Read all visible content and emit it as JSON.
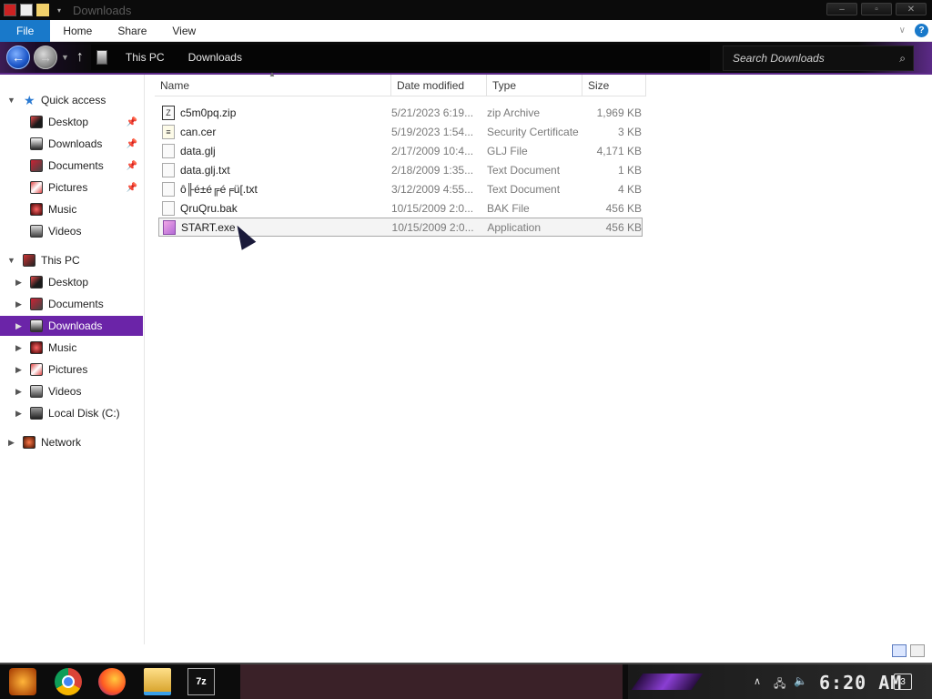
{
  "window": {
    "title": "Downloads",
    "controls": {
      "minimize": "–",
      "maximize": "▫",
      "close": "✕"
    }
  },
  "ribbon": {
    "tabs": [
      "File",
      "Home",
      "Share",
      "View"
    ],
    "help": "?"
  },
  "nav": {
    "breadcrumb": [
      "This PC",
      "Downloads"
    ],
    "search_placeholder": "Search Downloads"
  },
  "sidebar": {
    "quick_access": "Quick access",
    "quick_items": [
      {
        "label": "Desktop",
        "pinned": true
      },
      {
        "label": "Downloads",
        "pinned": true
      },
      {
        "label": "Documents",
        "pinned": true
      },
      {
        "label": "Pictures",
        "pinned": true
      },
      {
        "label": "Music",
        "pinned": false
      },
      {
        "label": "Videos",
        "pinned": false
      }
    ],
    "this_pc": "This PC",
    "pc_items": [
      "Desktop",
      "Documents",
      "Downloads",
      "Music",
      "Pictures",
      "Videos",
      "Local Disk (C:)"
    ],
    "selected": "Downloads",
    "network": "Network"
  },
  "columns": [
    "Name",
    "Date modified",
    "Type",
    "Size"
  ],
  "files": [
    {
      "name": "c5m0pq.zip",
      "date": "5/21/2023 6:19...",
      "type": "zip Archive",
      "size": "1,969 KB",
      "icon": "zip-icon"
    },
    {
      "name": "can.cer",
      "date": "5/19/2023 1:54...",
      "type": "Security Certificate",
      "size": "3 KB",
      "icon": "certificate-icon"
    },
    {
      "name": "data.glj",
      "date": "2/17/2009 10:4...",
      "type": "GLJ File",
      "size": "4,171 KB",
      "icon": "file-icon"
    },
    {
      "name": "data.glj.txt",
      "date": "2/18/2009 1:35...",
      "type": "Text Document",
      "size": "1 KB",
      "icon": "file-icon"
    },
    {
      "name": "ô╟é±é╔é╒ü[.txt",
      "date": "3/12/2009 4:55...",
      "type": "Text Document",
      "size": "4 KB",
      "icon": "file-icon"
    },
    {
      "name": "QruQru.bak",
      "date": "10/15/2009 2:0...",
      "type": "BAK File",
      "size": "456 KB",
      "icon": "file-icon"
    },
    {
      "name": "START.exe",
      "date": "10/15/2009 2:0...",
      "type": "Application",
      "size": "456 KB",
      "icon": "exe-icon"
    }
  ],
  "taskbar": {
    "clock": "6:20 AM",
    "notifications": "3",
    "pinned": [
      "start-button",
      "chrome-icon",
      "firefox-icon",
      "file-explorer-icon",
      "7zip-icon"
    ],
    "zip_label": "7z"
  }
}
